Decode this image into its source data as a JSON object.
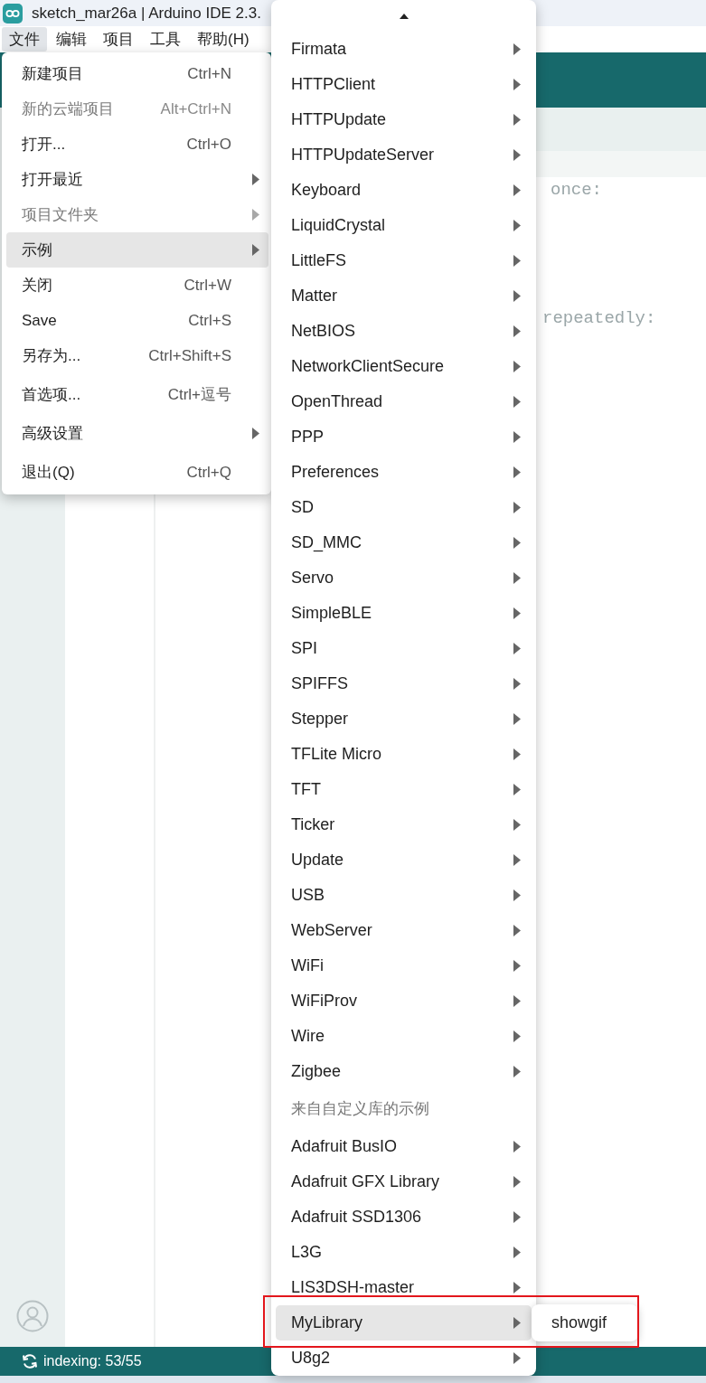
{
  "window": {
    "title": "sketch_mar26a | Arduino IDE 2.3."
  },
  "menu_bar": [
    {
      "label": "文件",
      "selected": true
    },
    {
      "label": "编辑",
      "selected": false
    },
    {
      "label": "项目",
      "selected": false
    },
    {
      "label": "工具",
      "selected": false
    },
    {
      "label": "帮助(H)",
      "selected": false
    }
  ],
  "editor": {
    "lines": [
      "once:",
      "repeatedly:"
    ]
  },
  "status_bar": {
    "text": "indexing: 53/55"
  },
  "file_menu": {
    "groups": [
      [
        {
          "label": "新建项目",
          "shortcut": "Ctrl+N",
          "kind": "command",
          "disabled": false,
          "selected": false
        },
        {
          "label": "新的云端项目",
          "shortcut": "Alt+Ctrl+N",
          "kind": "command",
          "disabled": true,
          "selected": false
        },
        {
          "label": "打开...",
          "shortcut": "Ctrl+O",
          "kind": "command",
          "disabled": false,
          "selected": false
        },
        {
          "label": "打开最近",
          "kind": "submenu",
          "disabled": false,
          "selected": false
        },
        {
          "label": "项目文件夹",
          "kind": "submenu",
          "disabled": true,
          "selected": false
        },
        {
          "label": "示例",
          "kind": "submenu",
          "disabled": false,
          "selected": true
        },
        {
          "label": "关闭",
          "shortcut": "Ctrl+W",
          "kind": "command",
          "disabled": false,
          "selected": false
        },
        {
          "label": "Save",
          "shortcut": "Ctrl+S",
          "kind": "command",
          "disabled": false,
          "selected": false
        },
        {
          "label": "另存为...",
          "shortcut": "Ctrl+Shift+S",
          "kind": "command",
          "disabled": false,
          "selected": false
        }
      ],
      [
        {
          "label": "首选项...",
          "shortcut": "Ctrl+逗号",
          "kind": "command",
          "disabled": false,
          "selected": false
        }
      ],
      [
        {
          "label": "高级设置",
          "kind": "submenu",
          "disabled": false,
          "selected": false
        }
      ],
      [
        {
          "label": "退出(Q)",
          "shortcut": "Ctrl+Q",
          "kind": "command",
          "disabled": false,
          "selected": false
        }
      ]
    ]
  },
  "examples_menu": {
    "sections": [
      {
        "items": [
          {
            "label": "Firmata",
            "selected": false
          },
          {
            "label": "HTTPClient",
            "selected": false
          },
          {
            "label": "HTTPUpdate",
            "selected": false
          },
          {
            "label": "HTTPUpdateServer",
            "selected": false
          },
          {
            "label": "Keyboard",
            "selected": false
          },
          {
            "label": "LiquidCrystal",
            "selected": false
          },
          {
            "label": "LittleFS",
            "selected": false
          },
          {
            "label": "Matter",
            "selected": false
          },
          {
            "label": "NetBIOS",
            "selected": false
          },
          {
            "label": "NetworkClientSecure",
            "selected": false
          },
          {
            "label": "OpenThread",
            "selected": false
          },
          {
            "label": "PPP",
            "selected": false
          },
          {
            "label": "Preferences",
            "selected": false
          },
          {
            "label": "SD",
            "selected": false
          },
          {
            "label": "SD_MMC",
            "selected": false
          },
          {
            "label": "Servo",
            "selected": false
          },
          {
            "label": "SimpleBLE",
            "selected": false
          },
          {
            "label": "SPI",
            "selected": false
          },
          {
            "label": "SPIFFS",
            "selected": false
          },
          {
            "label": "Stepper",
            "selected": false
          },
          {
            "label": "TFLite Micro",
            "selected": false
          },
          {
            "label": "TFT",
            "selected": false
          },
          {
            "label": "Ticker",
            "selected": false
          },
          {
            "label": "Update",
            "selected": false
          },
          {
            "label": "USB",
            "selected": false
          },
          {
            "label": "WebServer",
            "selected": false
          },
          {
            "label": "WiFi",
            "selected": false
          },
          {
            "label": "WiFiProv",
            "selected": false
          },
          {
            "label": "Wire",
            "selected": false
          },
          {
            "label": "Zigbee",
            "selected": false
          }
        ]
      },
      {
        "title": "来自自定义库的示例",
        "items": [
          {
            "label": "Adafruit BusIO",
            "selected": false
          },
          {
            "label": "Adafruit GFX Library",
            "selected": false
          },
          {
            "label": "Adafruit SSD1306",
            "selected": false
          },
          {
            "label": "L3G",
            "selected": false
          },
          {
            "label": "LIS3DSH-master",
            "selected": false
          },
          {
            "label": "MyLibrary",
            "selected": true
          },
          {
            "label": "U8g2",
            "selected": false
          }
        ]
      }
    ]
  },
  "library_submenu": {
    "items": [
      {
        "label": "showgif",
        "selected": false
      }
    ]
  }
}
